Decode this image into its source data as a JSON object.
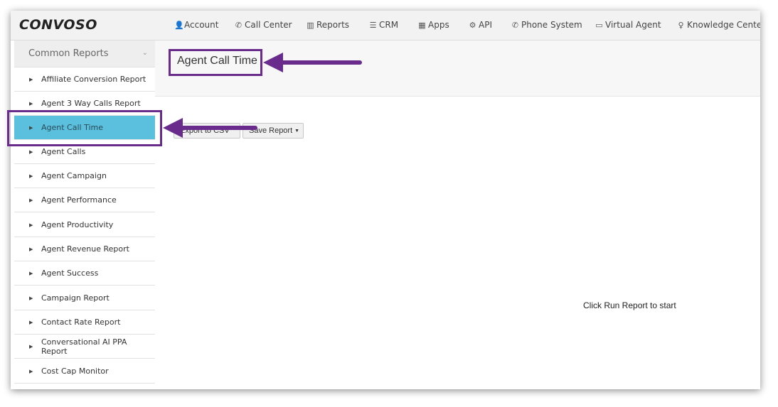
{
  "brand": {
    "logo": "CONVOSO"
  },
  "nav": [
    {
      "icon": "user-icon",
      "glyph": "👤",
      "label": "Account"
    },
    {
      "icon": "phone-icon",
      "glyph": "✆",
      "label": "Call Center"
    },
    {
      "icon": "bar-chart-icon",
      "glyph": "▥",
      "label": "Reports"
    },
    {
      "icon": "list-icon",
      "glyph": "☰",
      "label": "CRM"
    },
    {
      "icon": "grid-icon",
      "glyph": "▦",
      "label": "Apps"
    },
    {
      "icon": "gear-icon",
      "glyph": "⚙",
      "label": "API"
    },
    {
      "icon": "phone-icon",
      "glyph": "✆",
      "label": "Phone System"
    },
    {
      "icon": "monitor-icon",
      "glyph": "▭",
      "label": "Virtual Agent"
    },
    {
      "icon": "lightbulb-icon",
      "glyph": "♀",
      "label": "Knowledge Center"
    }
  ],
  "sidebar": {
    "header": "Common Reports",
    "items": [
      {
        "label": "Affiliate Conversion Report"
      },
      {
        "label": "Agent 3 Way Calls Report"
      },
      {
        "label": "Agent Call Time",
        "active": true
      },
      {
        "label": "Agent Calls"
      },
      {
        "label": "Agent Campaign"
      },
      {
        "label": "Agent Performance"
      },
      {
        "label": "Agent Productivity"
      },
      {
        "label": "Agent Revenue Report"
      },
      {
        "label": "Agent Success"
      },
      {
        "label": "Campaign Report"
      },
      {
        "label": "Contact Rate Report"
      },
      {
        "label": "Conversational AI PPA Report"
      },
      {
        "label": "Cost Cap Monitor"
      }
    ]
  },
  "main": {
    "title": "Agent Call Time",
    "export_label": "Export to CSV",
    "save_label": "Save Report",
    "empty_message": "Click Run Report to start"
  },
  "annotation_color": "#6a2c8c",
  "active_color": "#5bc0de"
}
